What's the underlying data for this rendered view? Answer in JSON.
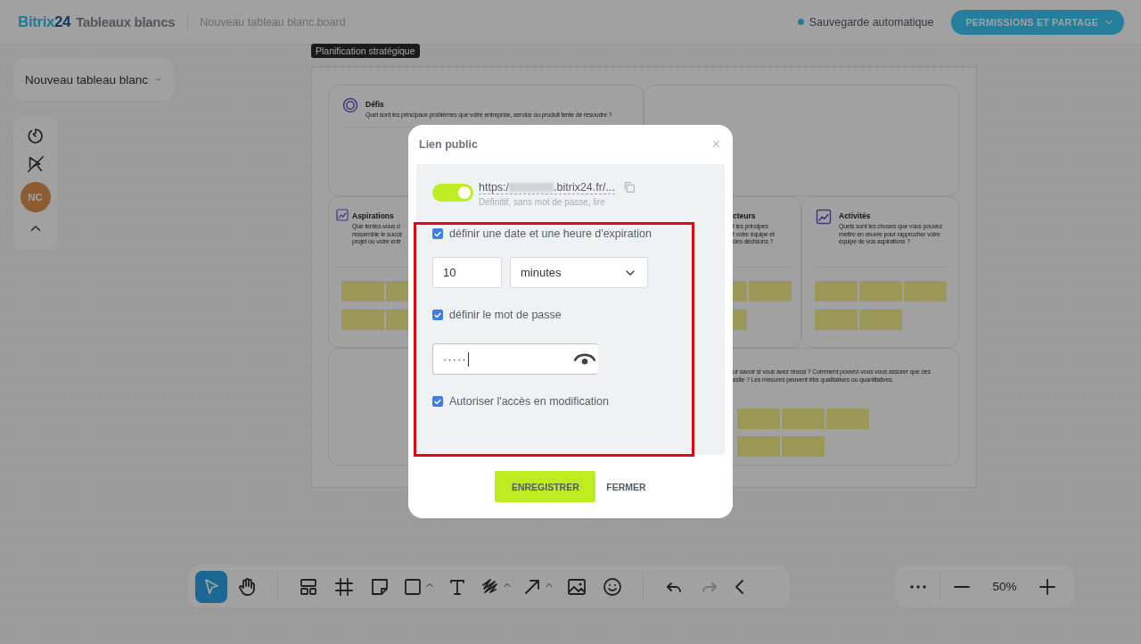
{
  "header": {
    "logo_brand": "Bitrix",
    "logo_number": "24",
    "product": "Tableaux blancs",
    "file_name": "Nouveau tableau blanc.board",
    "autosave": "Sauvegarde automatique",
    "share_button": "PERMISSIONS ET PARTAGE"
  },
  "board_menu": {
    "label": "Nouveau tableau blanc"
  },
  "side_tools": {
    "avatar": "NC"
  },
  "board": {
    "tooltip": "Planification stratégique",
    "cards": [
      {
        "kind": "head",
        "title": "Défis",
        "description": [
          "Quel sont les principaux problèmes que votre entreprise, service ou produit tente de résoudre ?"
        ]
      },
      {
        "kind": "blank"
      },
      {
        "kind": "column-left",
        "title": "Aspirations",
        "description": [
          "Que tentez-vous d",
          "ressemble le succè",
          "projet ou votre entr"
        ]
      },
      {
        "kind": "column-cut",
        "title": "cteurs",
        "description": [
          "t les principes",
          "t votre équipe et",
          "des décisions ?"
        ]
      },
      {
        "kind": "column",
        "title": "Activités",
        "description": [
          "Quels sont les choses que vous pouvez",
          "mettre en œuvre pour rapprocher votre",
          "équipe de vos aspirations ?"
        ]
      },
      {
        "kind": "blank"
      },
      {
        "kind": "wide-cut",
        "description": [
          "ur savoir si vous avez réussi ? Comment pouvez-vous vous assurer que ces",
          "ssite ? Les mesures peuvent être qualitatives ou quantitatives."
        ]
      }
    ]
  },
  "dialog": {
    "title": "Lien public",
    "close": "×",
    "link": {
      "on": true,
      "url_start": "https:/",
      "url_end": ".bitrix24.fr/...",
      "summary": "Définitif, sans mot de passe, lire"
    },
    "expiration": {
      "label": "définir une date et une heure d'expiration",
      "checked": true,
      "amount": "10",
      "unit": "minutes"
    },
    "password": {
      "label": "définir le mot de passe",
      "checked": true,
      "value": "·····"
    },
    "edit_access": {
      "label": "Autoriser l'accès en modification",
      "checked": true
    },
    "buttons": [
      {
        "kind": "primary",
        "label": "ENREGISTRER"
      },
      {
        "kind": "link",
        "label": "FERMER"
      }
    ]
  },
  "toolbar": {
    "tools": [
      {
        "kind": "pointer",
        "selected": true,
        "disabled": false
      },
      {
        "kind": "hand",
        "selected": false,
        "disabled": false
      },
      {
        "kind": "divider"
      },
      {
        "kind": "templates",
        "selected": false,
        "disabled": false
      },
      {
        "kind": "frame",
        "selected": false,
        "disabled": false
      },
      {
        "kind": "sticky",
        "selected": false,
        "disabled": false
      },
      {
        "kind": "shape",
        "selected": false,
        "disabled": false
      },
      {
        "kind": "text",
        "selected": false,
        "disabled": false
      },
      {
        "kind": "pen",
        "selected": false,
        "disabled": false
      },
      {
        "kind": "arrow",
        "selected": false,
        "disabled": false
      },
      {
        "kind": "image",
        "selected": false,
        "disabled": false
      },
      {
        "kind": "emoji",
        "selected": false,
        "disabled": false
      },
      {
        "kind": "divider"
      },
      {
        "kind": "undo",
        "selected": false,
        "disabled": false
      },
      {
        "kind": "redo",
        "selected": false,
        "disabled": true
      },
      {
        "kind": "collapse",
        "selected": false,
        "disabled": false
      }
    ]
  },
  "zoom": {
    "level": "50%"
  }
}
